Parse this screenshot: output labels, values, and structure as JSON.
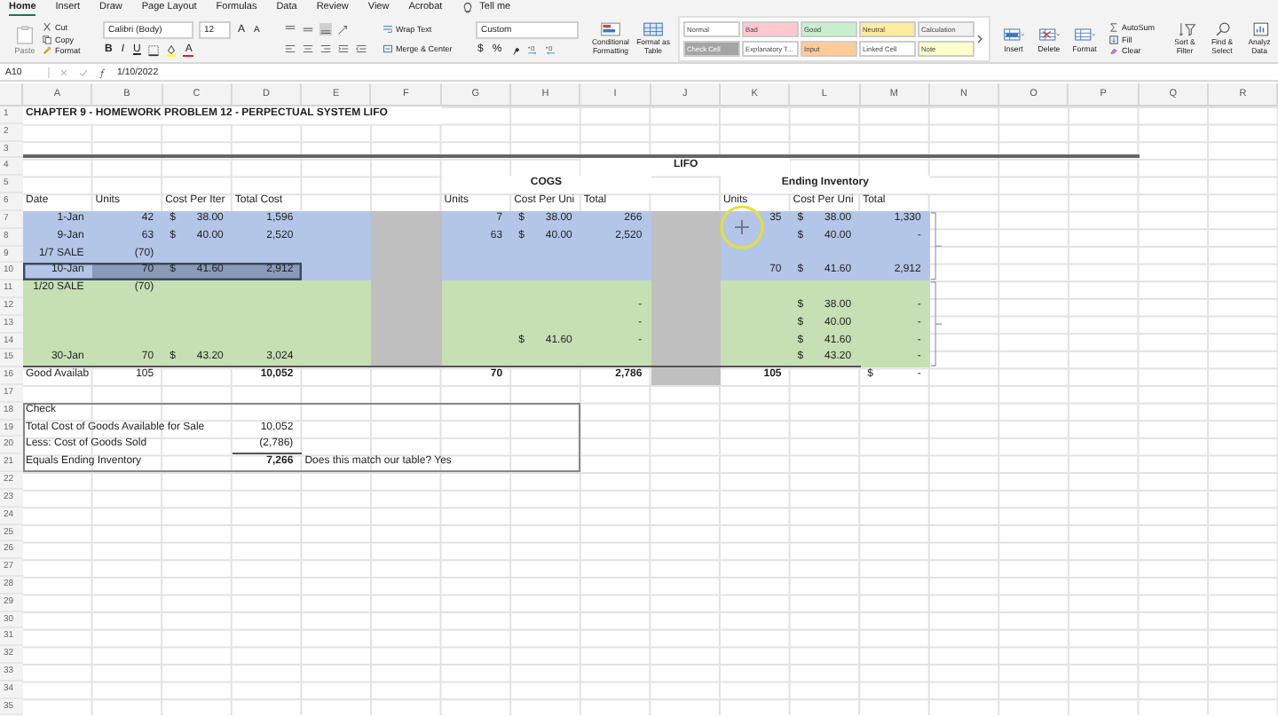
{
  "ribbon": {
    "tabs": [
      {
        "label": "Home",
        "selected": true
      },
      {
        "label": "Insert",
        "selected": false
      },
      {
        "label": "Draw",
        "selected": false
      },
      {
        "label": "Page Layout",
        "selected": false
      },
      {
        "label": "Formulas",
        "selected": false
      },
      {
        "label": "Data",
        "selected": false
      },
      {
        "label": "Review",
        "selected": false
      },
      {
        "label": "View",
        "selected": false
      },
      {
        "label": "Acrobat",
        "selected": false
      }
    ],
    "tell_me": "Tell me",
    "paste": {
      "label": "Paste",
      "disabled": true
    },
    "clipboard": [
      "Cut",
      "Copy",
      "Format"
    ],
    "font": {
      "family": "Calibri (Body)",
      "size": "12",
      "grow": "A",
      "shrink": "A",
      "bold": "B",
      "italic": "I",
      "underline": "U",
      "font_color_glyph": "A"
    },
    "alignment": {
      "wrap": "Wrap Text",
      "merge": "Merge & Center"
    },
    "number": {
      "format": "Custom",
      "currency": "$",
      "percent": "%"
    },
    "formatting": [
      "Conditional Formatting",
      "Format as Table"
    ],
    "styles": [
      {
        "label": "Normal",
        "color": "#ffffff"
      },
      {
        "label": "Bad",
        "color": "#ffc7ce"
      },
      {
        "label": "Good",
        "color": "#c6efce"
      },
      {
        "label": "Neutral",
        "color": "#ffeb9c"
      },
      {
        "label": "Calculation",
        "color": "#f2f2f2"
      },
      {
        "label": "Check Cell",
        "color": "#a5a5a5"
      },
      {
        "label": "Explanatory T...",
        "color": "#ffffff"
      },
      {
        "label": "Input",
        "color": "#ffcc99"
      },
      {
        "label": "Linked Cell",
        "color": "#ffffff"
      },
      {
        "label": "Note",
        "color": "#ffffcc"
      }
    ],
    "cells": [
      "Insert",
      "Delete",
      "Format"
    ],
    "editing": [
      "AutoSum",
      "Fill",
      "Clear"
    ],
    "tools": [
      "Sort & Filter",
      "Find & Select",
      "Analyz Data"
    ]
  },
  "formula_bar": {
    "name_box": "A10",
    "formula": "1/10/2022"
  },
  "sheet": {
    "columns": [
      "A",
      "B",
      "C",
      "D",
      "E",
      "F",
      "G",
      "H",
      "I",
      "J",
      "K",
      "L",
      "M",
      "N",
      "O",
      "P",
      "Q",
      "R"
    ],
    "rows": [
      {
        "number": "1",
        "cells": {
          "A": {
            "kind": "title",
            "text": "CHAPTER 9 - HOMEWORK PROBLEM 12 - PERPECTUAL SYSTEM LIFO",
            "selected": false
          }
        }
      },
      {
        "number": "2",
        "cells": {}
      },
      {
        "number": "3",
        "cells": {}
      },
      {
        "number": "4",
        "cells": {
          "J": {
            "kind": "heading",
            "text": "LIFO",
            "selected": false
          }
        }
      },
      {
        "number": "5",
        "cells": {
          "H": {
            "kind": "heading",
            "text": "COGS",
            "selected": false
          },
          "L": {
            "kind": "heading",
            "text": "Ending Inventory",
            "selected": false
          }
        }
      },
      {
        "number": "6",
        "cells": {
          "A": {
            "kind": "text",
            "text": "Date",
            "selected": false
          },
          "B": {
            "kind": "text",
            "text": "Units",
            "selected": false
          },
          "C": {
            "kind": "text",
            "text": "Cost Per Iter",
            "selected": false
          },
          "D": {
            "kind": "text",
            "text": "Total Cost",
            "selected": false
          },
          "G": {
            "kind": "text",
            "text": "Units",
            "selected": false
          },
          "H": {
            "kind": "text",
            "text": "Cost Per Uni",
            "selected": false
          },
          "I": {
            "kind": "text",
            "text": "Total",
            "selected": false
          },
          "K": {
            "kind": "text",
            "text": "Units",
            "selected": false
          },
          "L": {
            "kind": "text",
            "text": "Cost Per Uni",
            "selected": false
          },
          "M": {
            "kind": "text",
            "text": "Total",
            "selected": false
          }
        }
      },
      {
        "number": "7",
        "color": "#b4c6e7",
        "shaded": {
          "F": true,
          "J": true
        },
        "cells": {
          "A": {
            "kind": "number",
            "text": "1-Jan",
            "selected": false
          },
          "B": {
            "kind": "number",
            "text": "42",
            "selected": false
          },
          "C": {
            "kind": "currency",
            "symbol": "$",
            "text": "38.00",
            "selected": false
          },
          "D": {
            "kind": "number",
            "text": "1,596",
            "selected": false
          },
          "G": {
            "kind": "number",
            "text": "7",
            "selected": false
          },
          "H": {
            "kind": "currency",
            "symbol": "$",
            "text": "38.00",
            "selected": false
          },
          "I": {
            "kind": "number",
            "text": "266",
            "selected": false
          },
          "K": {
            "kind": "number",
            "text": "35",
            "selected": false
          },
          "L": {
            "kind": "currency",
            "symbol": "$",
            "text": "38.00",
            "selected": false
          },
          "M": {
            "kind": "number",
            "text": "1,330",
            "selected": false
          }
        }
      },
      {
        "number": "8",
        "color": "#b4c6e7",
        "shaded": {
          "F": true,
          "J": true
        },
        "cells": {
          "A": {
            "kind": "number",
            "text": "9-Jan",
            "selected": false
          },
          "B": {
            "kind": "number",
            "text": "63",
            "selected": false
          },
          "C": {
            "kind": "currency",
            "symbol": "$",
            "text": "40.00",
            "selected": false
          },
          "D": {
            "kind": "number",
            "text": "2,520",
            "selected": false
          },
          "G": {
            "kind": "number",
            "text": "63",
            "selected": false
          },
          "H": {
            "kind": "currency",
            "symbol": "$",
            "text": "40.00",
            "selected": false
          },
          "I": {
            "kind": "number",
            "text": "2,520",
            "selected": false
          },
          "L": {
            "kind": "currency",
            "symbol": "$",
            "text": "40.00",
            "selected": false
          },
          "M": {
            "kind": "number",
            "text": "-",
            "selected": false
          }
        }
      },
      {
        "number": "9",
        "color": "#b4c6e7",
        "shaded": {
          "F": true,
          "J": true
        },
        "cells": {
          "A": {
            "kind": "number",
            "text": "1/7 SALE",
            "selected": false
          },
          "B": {
            "kind": "number",
            "text": "(70)",
            "selected": false
          }
        }
      },
      {
        "number": "10",
        "color": "#b4c6e7",
        "shaded": {
          "F": true,
          "J": true
        },
        "cells": {
          "A": {
            "kind": "number",
            "text": "10-Jan",
            "selected": true
          },
          "B": {
            "kind": "number",
            "text": "70",
            "selected": true
          },
          "C": {
            "kind": "currency",
            "symbol": "$",
            "text": "41.60",
            "selected": true
          },
          "D": {
            "kind": "number",
            "text": "2,912",
            "selected": true
          },
          "K": {
            "kind": "number",
            "text": "70",
            "selected": false
          },
          "L": {
            "kind": "currency",
            "symbol": "$",
            "text": "41.60",
            "selected": false
          },
          "M": {
            "kind": "number",
            "text": "2,912",
            "selected": false
          }
        }
      },
      {
        "number": "11",
        "color": "#c6e0b4",
        "shaded": {
          "F": true,
          "J": true
        },
        "cells": {
          "A": {
            "kind": "number",
            "text": "1/20 SALE",
            "selected": false
          },
          "B": {
            "kind": "number",
            "text": "(70)",
            "selected": false
          }
        }
      },
      {
        "number": "12",
        "color": "#c6e0b4",
        "shaded": {
          "F": true,
          "J": true
        },
        "cells": {
          "I": {
            "kind": "number",
            "text": "-",
            "selected": false
          },
          "L": {
            "kind": "currency",
            "symbol": "$",
            "text": "38.00",
            "selected": false
          },
          "M": {
            "kind": "number",
            "text": "-",
            "selected": false
          }
        }
      },
      {
        "number": "13",
        "color": "#c6e0b4",
        "shaded": {
          "F": true,
          "J": true
        },
        "cells": {
          "I": {
            "kind": "number",
            "text": "-",
            "selected": false
          },
          "L": {
            "kind": "currency",
            "symbol": "$",
            "text": "40.00",
            "selected": false
          },
          "M": {
            "kind": "number",
            "text": "-",
            "selected": false
          }
        }
      },
      {
        "number": "14",
        "color": "#c6e0b4",
        "shaded": {
          "F": true,
          "J": true
        },
        "cells": {
          "H": {
            "kind": "currency",
            "symbol": "$",
            "text": "41.60",
            "selected": false
          },
          "I": {
            "kind": "number",
            "text": "-",
            "selected": false
          },
          "L": {
            "kind": "currency",
            "symbol": "$",
            "text": "41.60",
            "selected": false
          },
          "M": {
            "kind": "number",
            "text": "-",
            "selected": false
          }
        }
      },
      {
        "number": "15",
        "color": "#c6e0b4",
        "shaded": {
          "F": true,
          "J": true
        },
        "cells": {
          "A": {
            "kind": "number",
            "text": "30-Jan",
            "selected": false
          },
          "B": {
            "kind": "number",
            "text": "70",
            "selected": false
          },
          "C": {
            "kind": "currency",
            "symbol": "$",
            "text": "43.20",
            "selected": false
          },
          "D": {
            "kind": "number",
            "text": "3,024",
            "selected": false
          },
          "L": {
            "kind": "currency",
            "symbol": "$",
            "text": "43.20",
            "selected": false
          },
          "M": {
            "kind": "number",
            "text": "-",
            "selected": false
          }
        }
      },
      {
        "number": "16",
        "shaded": {
          "J": true
        },
        "cells": {
          "A": {
            "kind": "text",
            "text": "Good Availab",
            "selected": false
          },
          "B": {
            "kind": "number",
            "text": "105",
            "selected": false
          },
          "D": {
            "kind": "total",
            "text": "10,052",
            "selected": false
          },
          "G": {
            "kind": "total",
            "text": "70",
            "selected": false
          },
          "I": {
            "kind": "total",
            "text": "2,786",
            "selected": false
          },
          "K": {
            "kind": "total",
            "text": "105",
            "selected": false
          },
          "M": {
            "kind": "currency",
            "symbol": "$",
            "text": "-",
            "selected": false
          }
        }
      },
      {
        "number": "17",
        "cells": {}
      },
      {
        "number": "18",
        "cells": {
          "A": {
            "kind": "text",
            "text": "Check",
            "selected": false
          }
        }
      },
      {
        "number": "19",
        "cells": {
          "A": {
            "kind": "text",
            "text": "Total Cost of Goods Available for Sale",
            "selected": false
          },
          "D": {
            "kind": "number",
            "text": "10,052",
            "selected": false
          }
        }
      },
      {
        "number": "20",
        "cells": {
          "A": {
            "kind": "text",
            "text": "Less:  Cost of Goods Sold",
            "selected": false
          },
          "D": {
            "kind": "number",
            "text": "(2,786)",
            "selected": false
          }
        }
      },
      {
        "number": "21",
        "cells": {
          "A": {
            "kind": "text",
            "text": "Equals Ending Inventory",
            "selected": false
          },
          "D": {
            "kind": "total",
            "text": "7,266",
            "selected": false
          },
          "E": {
            "kind": "text",
            "text": "Does this match our table?  Yes",
            "selected": false
          }
        }
      },
      {
        "number": "22",
        "cells": {}
      },
      {
        "number": "23",
        "cells": {}
      },
      {
        "number": "24",
        "cells": {}
      },
      {
        "number": "25",
        "cells": {}
      },
      {
        "number": "26",
        "cells": {}
      },
      {
        "number": "27",
        "cells": {}
      },
      {
        "number": "28",
        "cells": {}
      },
      {
        "number": "29",
        "cells": {}
      },
      {
        "number": "30",
        "cells": {}
      },
      {
        "number": "31",
        "cells": {}
      },
      {
        "number": "32",
        "cells": {}
      },
      {
        "number": "33",
        "cells": {}
      },
      {
        "number": "34",
        "cells": {}
      },
      {
        "number": "35",
        "cells": {}
      }
    ]
  }
}
